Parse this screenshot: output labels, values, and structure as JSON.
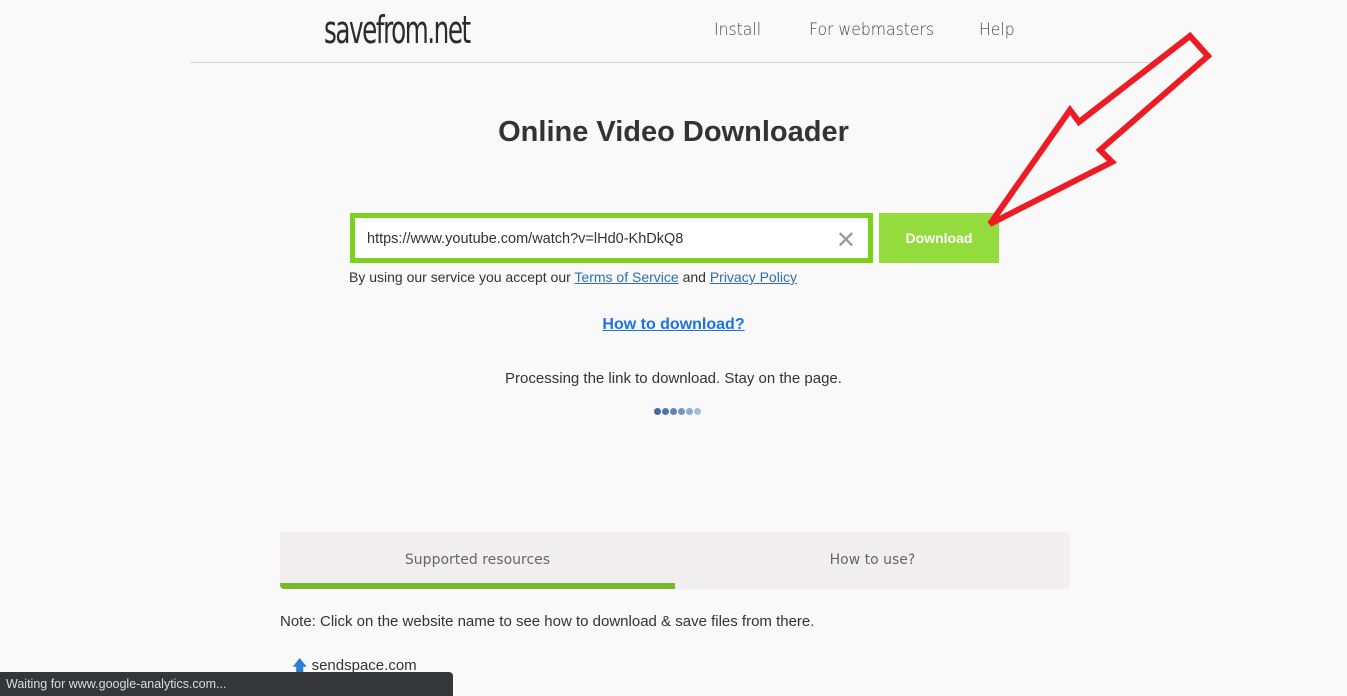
{
  "header": {
    "logo": "savefrom.net",
    "nav": [
      "Install",
      "For webmasters",
      "Help"
    ]
  },
  "main": {
    "title": "Online Video Downloader",
    "url_value": "https://www.youtube.com/watch?v=lHd0-KhDkQ8",
    "clear_icon": "close-icon",
    "download_label": "Download",
    "terms_prefix": "By using our service you accept our",
    "terms_link": "Terms of Service",
    "terms_and": "and",
    "privacy_link": "Privacy Policy",
    "how_to": "How to download?",
    "processing": "Processing the link to download. Stay on the page."
  },
  "tabs": [
    {
      "label": "Supported resources",
      "active": true
    },
    {
      "label": "How to use?",
      "active": false
    }
  ],
  "note": "Note: Click on the website name to see how to download & save files from there.",
  "resources": [
    {
      "icon": "upload-arrow-icon",
      "label": "sendspace.com"
    }
  ],
  "status_bar": "Waiting for www.google-analytics.com...",
  "colors": {
    "accent": "#7bd11b",
    "button": "#94dc3e",
    "arrow": "#ec1c24",
    "link": "#1a73e8"
  }
}
